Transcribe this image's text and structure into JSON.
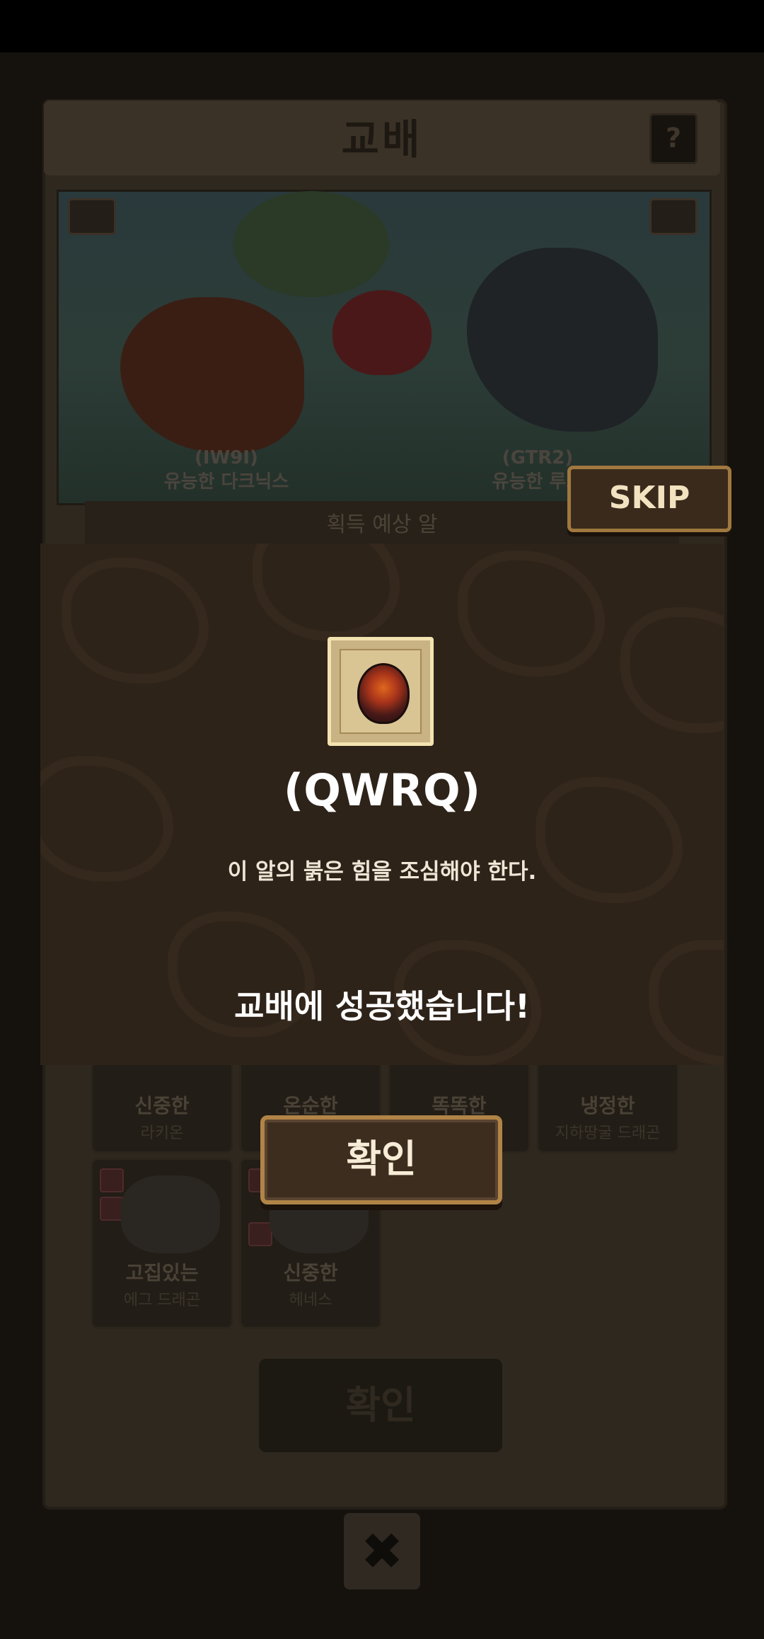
{
  "panel": {
    "title": "교배",
    "help_label": "?",
    "left_dragon": {
      "code": "(IW9I)",
      "name": "유능한 다크닉스"
    },
    "right_dragon": {
      "code": "(GTR2)",
      "name": "유능한 루드"
    },
    "expect_label": "획득 예상 알",
    "cards": [
      {
        "trait": "신중한",
        "name": "라키온"
      },
      {
        "trait": "온순한",
        "name": ""
      },
      {
        "trait": "똑똑한",
        "name": ""
      },
      {
        "trait": "냉정한",
        "name": "지하땅굴 드래곤"
      },
      {
        "trait": "고집있는",
        "name": "에그 드래곤"
      },
      {
        "trait": "신중한",
        "name": "헤네스"
      }
    ],
    "confirm_dim_label": "확인",
    "close_icon_label": "✖"
  },
  "skip_label": "SKIP",
  "result": {
    "egg_name": "(QWRQ)",
    "egg_description": "이 알의 붉은 힘을 조심해야 한다.",
    "message": "교배에 성공했습니다!",
    "confirm_label": "확인"
  },
  "colors": {
    "modal_bg": "#2e2319",
    "button_border": "#b08447",
    "text_white": "#ffffff"
  }
}
